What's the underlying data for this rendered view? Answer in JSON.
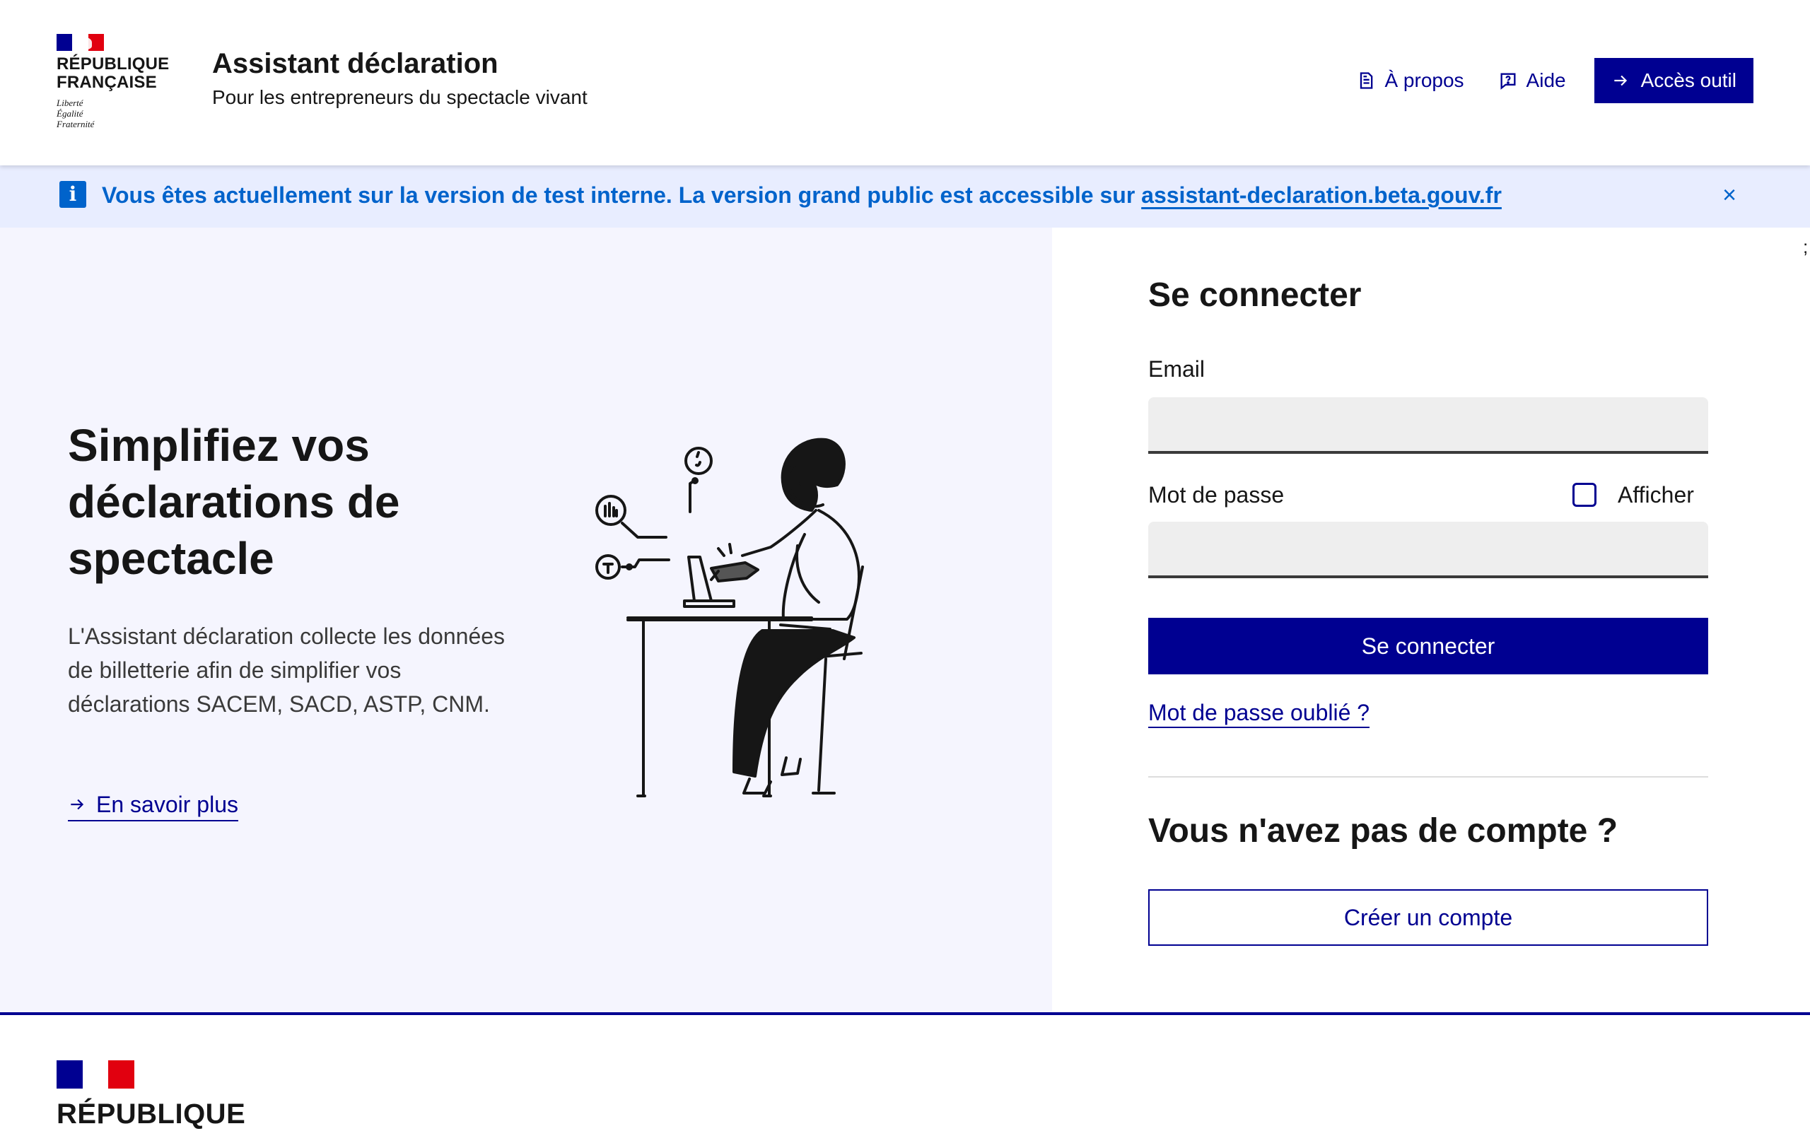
{
  "header": {
    "brand_line1": "RÉPUBLIQUE",
    "brand_line2": "FRANÇAISE",
    "devise": [
      "Liberté",
      "Égalité",
      "Fraternité"
    ],
    "service_title": "Assistant déclaration",
    "service_tagline": "Pour les entrepreneurs du spectacle vivant",
    "links": {
      "about": "À propos",
      "help": "Aide",
      "access": "Accès outil"
    },
    "icons": {
      "about": "document-icon",
      "help": "question-icon",
      "access": "arrow-right-icon"
    }
  },
  "notice": {
    "text": "Vous êtes actuellement sur la version de test interne. La version grand public est accessible sur ",
    "link_text": "assistant-declaration.beta.gouv.fr",
    "close_label": "×",
    "icon": "info-icon"
  },
  "hero": {
    "title": "Simplifiez vos déclarations de spectacle",
    "description": "L'Assistant déclaration collecte les données de billetterie afin de simplifier vos déclarations SACEM, SACD, ASTP, CNM.",
    "link": "En savoir plus"
  },
  "login": {
    "stray_char": ";",
    "title": "Se connecter",
    "email_label": "Email",
    "email_value": "",
    "password_label": "Mot de passe",
    "password_value": "",
    "show_label": "Afficher",
    "submit": "Se connecter",
    "forgot": "Mot de passe oublié ?",
    "no_account": "Vous n'avez pas de compte ?",
    "create": "Créer un compte"
  },
  "footer": {
    "brand": "RÉPUBLIQUE"
  },
  "colors": {
    "primary": "#000091",
    "info": "#0063cb",
    "notice_bg": "#e8edff",
    "hero_bg": "#f5f5fe",
    "flag_red": "#e1000f"
  }
}
